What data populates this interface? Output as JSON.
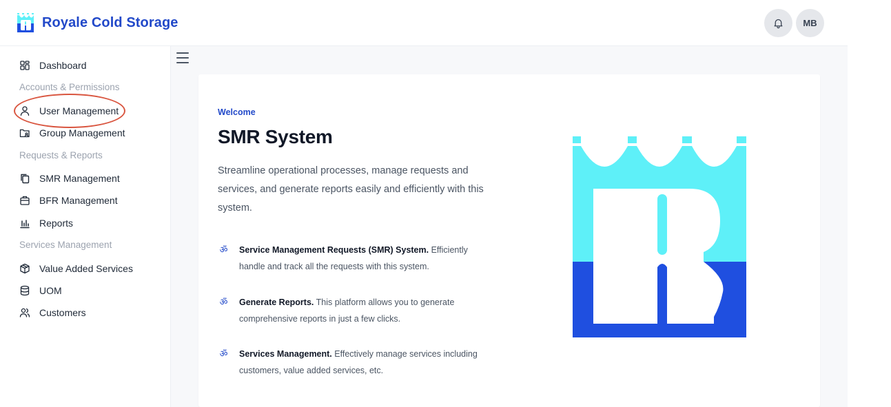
{
  "header": {
    "app_title": "Royale Cold Storage",
    "avatar_initials": "MB",
    "brand_colors": {
      "primary": "#2249c9",
      "logo_light": "#5ef0f8",
      "logo_dark": "#1f4fe0"
    }
  },
  "sidebar": {
    "dashboard": "Dashboard",
    "section_accounts": "Accounts & Permissions",
    "user_management": "User Management",
    "group_management": "Group Management",
    "section_requests": "Requests & Reports",
    "smr_management": "SMR Management",
    "bfr_management": "BFR Management",
    "reports": "Reports",
    "section_services": "Services Management",
    "value_added_services": "Value Added Services",
    "uom": "UOM",
    "customers": "Customers",
    "highlighted_item": "User Management",
    "highlight_color": "#d9553f"
  },
  "main": {
    "welcome_label": "Welcome",
    "title": "SMR System",
    "description": "Streamline operational processes, manage requests and services, and generate reports easily and efficiently with this system.",
    "features": [
      {
        "icon": "accessibility-icon",
        "title": "Service Management Requests (SMR) System.",
        "text": "Efficiently handle and track all the requests with this system."
      },
      {
        "icon": "accessibility-icon",
        "title": "Generate Reports.",
        "text": "This platform allows you to generate comprehensive reports in just a few clicks."
      },
      {
        "icon": "accessibility-icon",
        "title": "Services Management.",
        "text": "Effectively manage services including customers, value added services, etc."
      }
    ]
  }
}
